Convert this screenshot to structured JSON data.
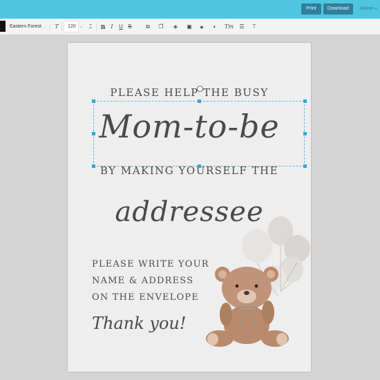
{
  "topbar": {
    "print_label": "Print",
    "download_label": "Download",
    "admin_label": "Admin",
    "accent": "#4ec6e0",
    "button_color": "#2e7f9b"
  },
  "toolbar": {
    "font_name": "Eastern Forest",
    "font_size": "120",
    "tools": [
      "text-style-icon",
      "bold-icon",
      "italic-icon",
      "underline-icon",
      "strikethrough-icon",
      "link-icon",
      "duplicate-icon",
      "layers-icon",
      "align-icon",
      "lock-icon",
      "color-icon",
      "text-transform-icon",
      "line-spacing-icon",
      "text-align-icon"
    ]
  },
  "card": {
    "line1": "PLEASE HELP THE BUSY",
    "line2": "Mom-to-be",
    "line3": "BY MAKING YOURSELF THE",
    "line4": "addressee",
    "instructions": [
      "PLEASE WRITE YOUR",
      "NAME & ADDRESS",
      "ON THE ENVELOPE"
    ],
    "thanks": "Thank you!",
    "text_color": "#4a4a4a",
    "background": "#eeeeee"
  }
}
